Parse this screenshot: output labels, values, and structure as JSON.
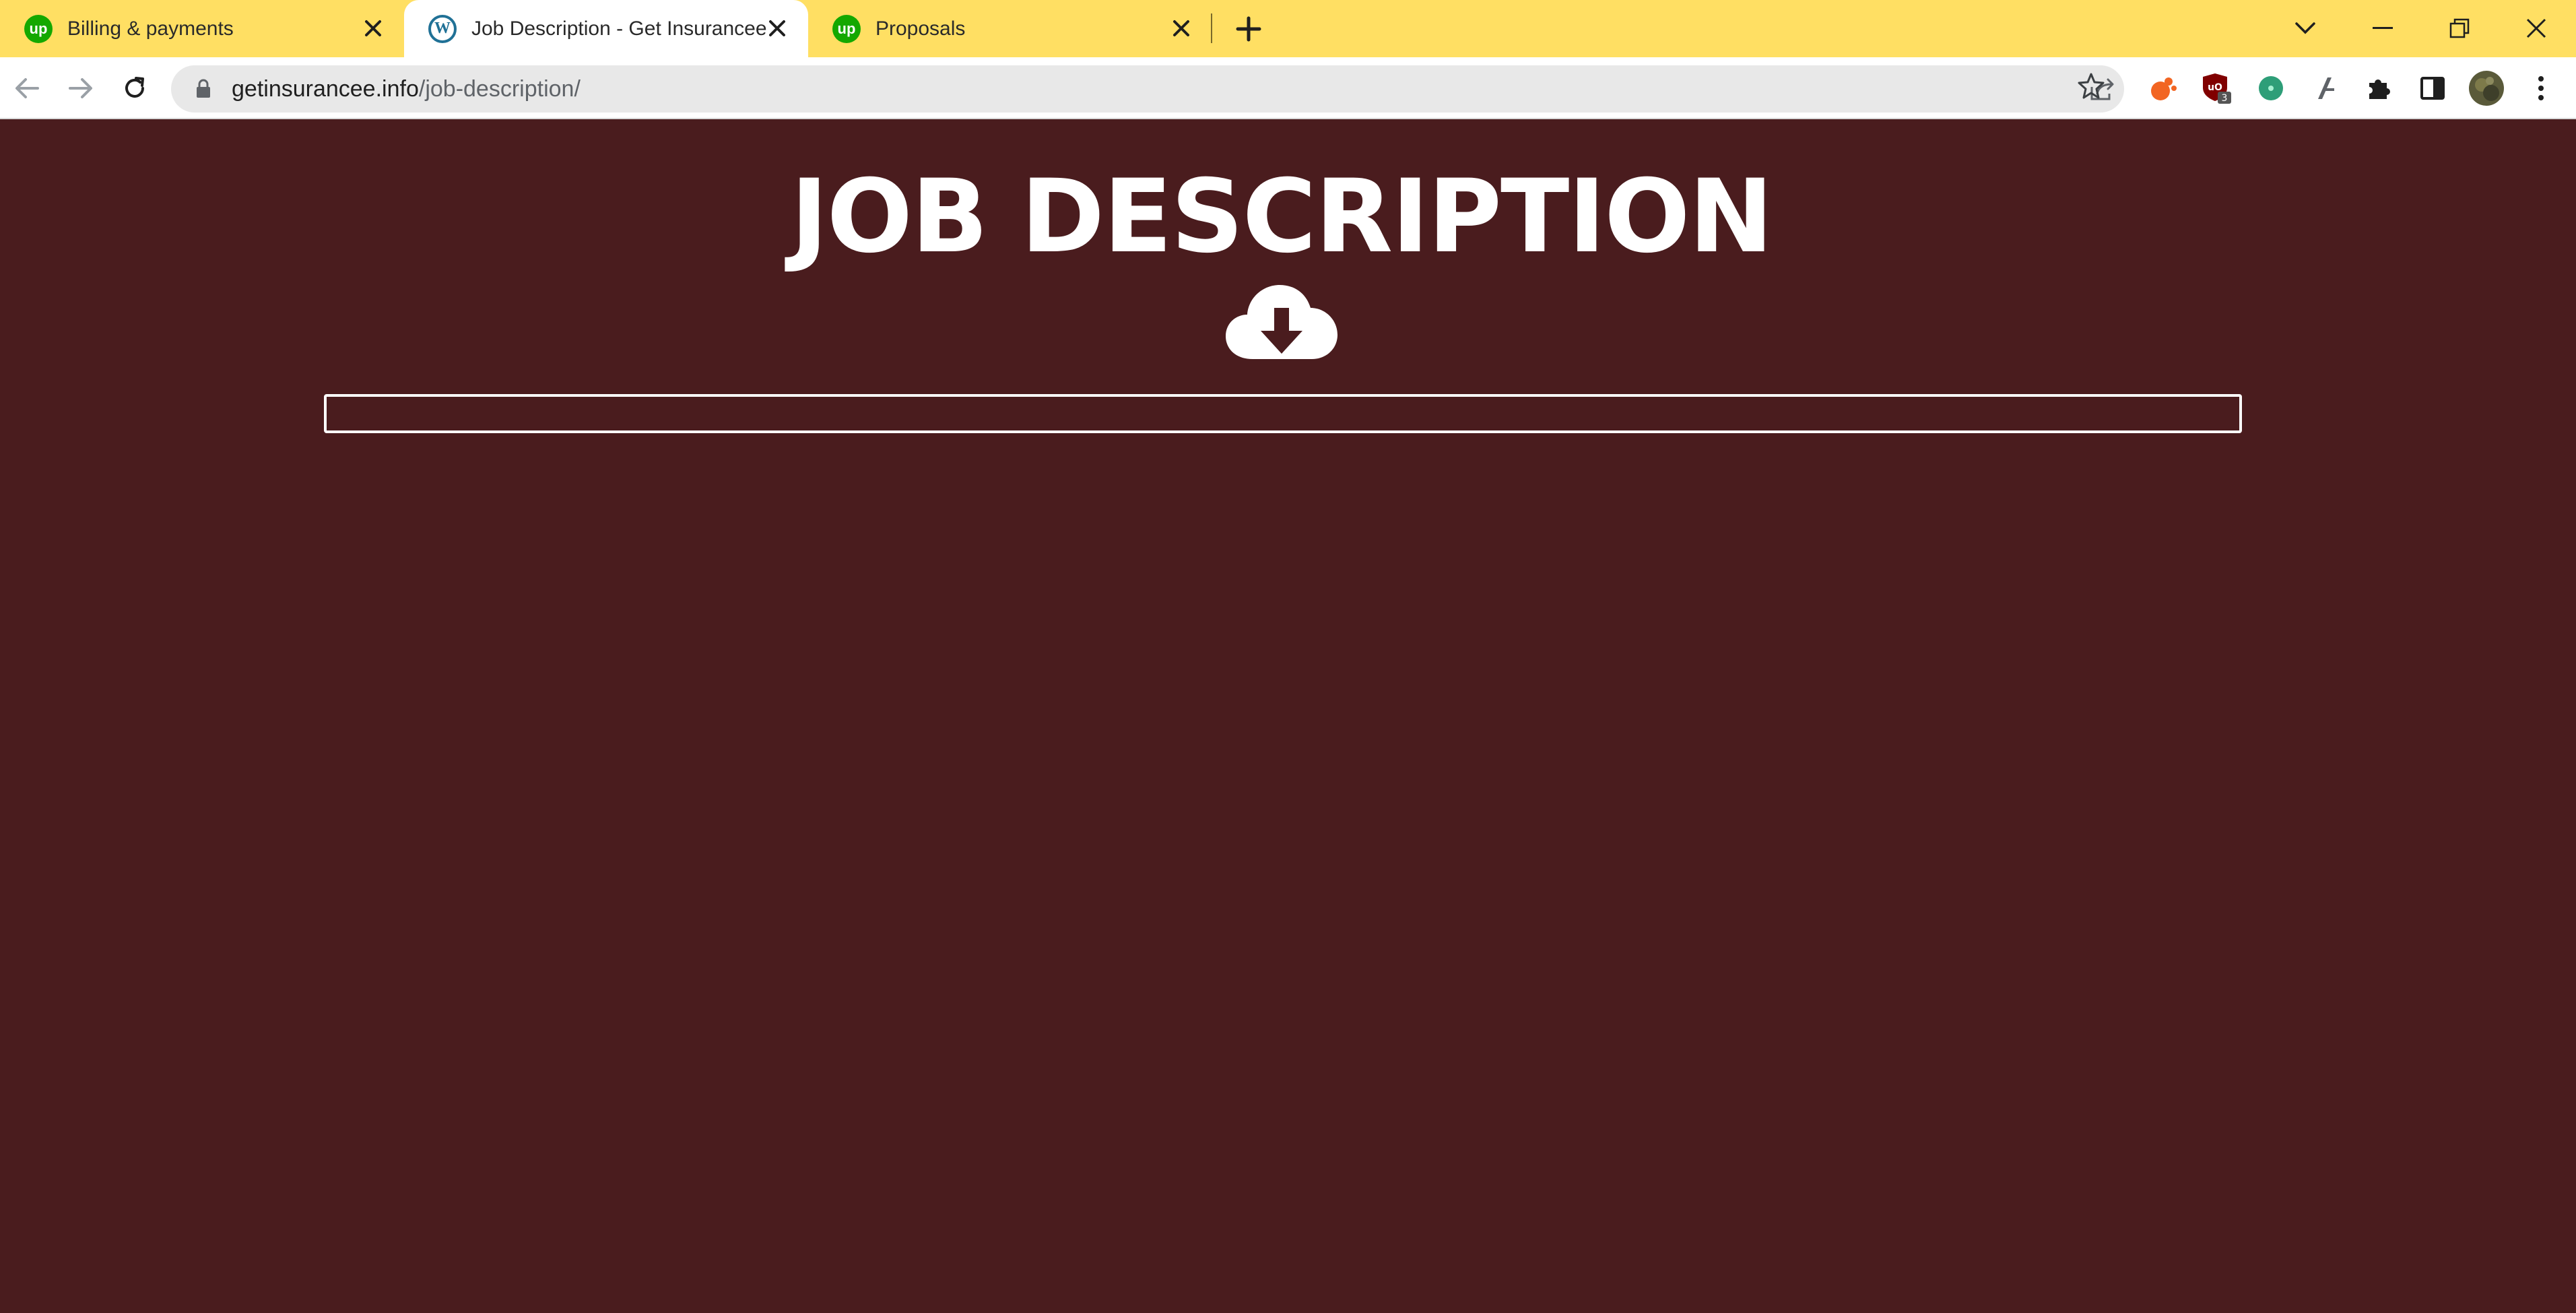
{
  "browser": {
    "tabs": [
      {
        "title": "Billing & payments",
        "favicon": "upwork-icon",
        "active": false
      },
      {
        "title": "Job Description - Get Insurancee",
        "favicon": "wordpress-icon",
        "active": true
      },
      {
        "title": "Proposals",
        "favicon": "upwork-icon",
        "active": false
      }
    ],
    "favicon_text": {
      "upwork": "up",
      "wordpress": "W"
    },
    "url_host": "getinsurancee.info",
    "url_path": "/job-description/",
    "extension_badge": "3",
    "colors": {
      "tabstrip": "#ffdf63",
      "page_background": "#4a1c1e",
      "upwork_green": "#14a800"
    }
  },
  "page": {
    "heading": "JOB DESCRIPTION",
    "icon": "cloud-download-icon",
    "input_value": "",
    "input_placeholder": ""
  }
}
